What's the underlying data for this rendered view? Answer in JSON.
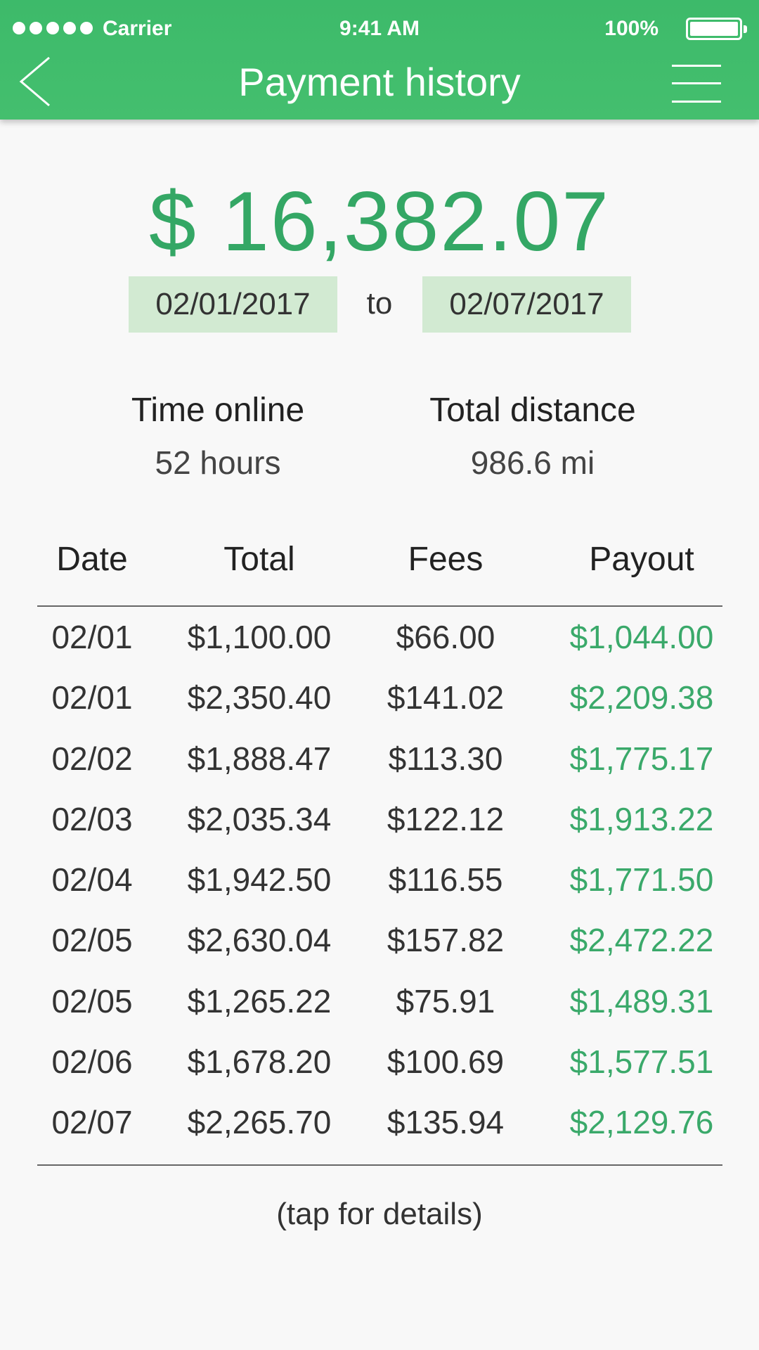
{
  "status_bar": {
    "carrier": "Carrier",
    "time": "9:41 AM",
    "battery": "100%",
    "signal_icon": "signal-dots-icon",
    "battery_icon": "battery-icon"
  },
  "nav": {
    "title": "Payment history",
    "back_icon": "chevron-left-icon",
    "menu_icon": "hamburger-menu-icon"
  },
  "summary": {
    "amount": "$ 16,382.07",
    "date_from": "02/01/2017",
    "to_label": "to",
    "date_to": "02/07/2017"
  },
  "stats": {
    "time_online_label": "Time online",
    "time_online_value": "52 hours",
    "total_distance_label": "Total distance",
    "total_distance_value": "986.6 mi"
  },
  "table": {
    "headers": {
      "date": "Date",
      "total": "Total",
      "fees": "Fees",
      "payout": "Payout"
    },
    "rows": [
      {
        "date": "02/01",
        "total": "$1,100.00",
        "fees": "$66.00",
        "payout": "$1,044.00"
      },
      {
        "date": "02/01",
        "total": "$2,350.40",
        "fees": "$141.02",
        "payout": "$2,209.38"
      },
      {
        "date": "02/02",
        "total": "$1,888.47",
        "fees": "$113.30",
        "payout": "$1,775.17"
      },
      {
        "date": "02/03",
        "total": "$2,035.34",
        "fees": "$122.12",
        "payout": "$1,913.22"
      },
      {
        "date": "02/04",
        "total": "$1,942.50",
        "fees": "$116.55",
        "payout": "$1,771.50"
      },
      {
        "date": "02/05",
        "total": "$2,630.04",
        "fees": "$157.82",
        "payout": "$2,472.22"
      },
      {
        "date": "02/05",
        "total": "$1,265.22",
        "fees": "$75.91",
        "payout": "$1,489.31"
      },
      {
        "date": "02/06",
        "total": "$1,678.20",
        "fees": "$100.69",
        "payout": "$1,577.51"
      },
      {
        "date": "02/07",
        "total": "$2,265.70",
        "fees": "$135.94",
        "payout": "$2,129.76"
      }
    ]
  },
  "hint": "(tap for details)",
  "colors": {
    "header_green": "#44bf6e",
    "amount_green": "#34a765",
    "payout_green": "#3aa96a",
    "date_chip_bg": "#d2ead2"
  }
}
